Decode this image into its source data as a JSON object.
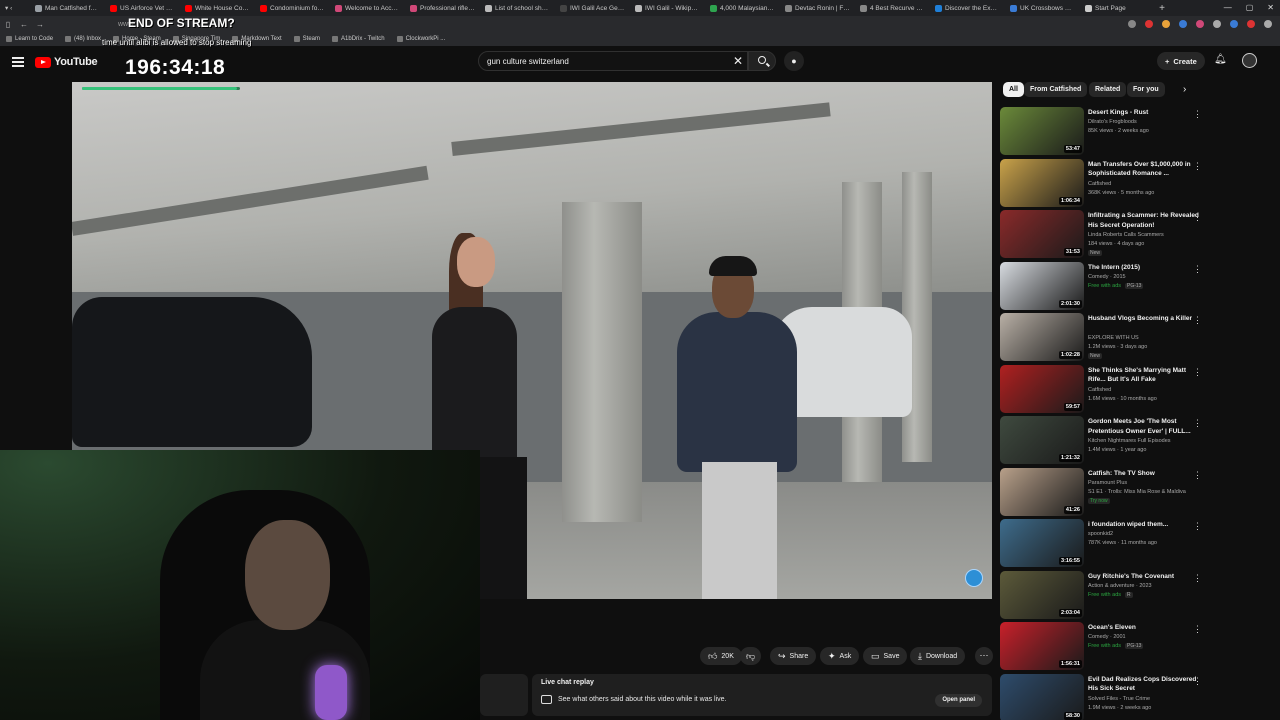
{
  "browser": {
    "tabs": [
      {
        "label": "Man Catfished for $2",
        "color": "#9aa0a6"
      },
      {
        "label": "US Airforce Vet Buys",
        "color": "#ff0000"
      },
      {
        "label": "White House Corresp",
        "color": "#ff0000"
      },
      {
        "label": "Condominium for Re",
        "color": "#ff0000"
      },
      {
        "label": "Welcome to Accurac",
        "color": "#d04878"
      },
      {
        "label": "Professional rifle syste",
        "color": "#d04878"
      },
      {
        "label": "List of school shootin",
        "color": "#bbbbbb"
      },
      {
        "label": "IWI Galil Ace Gen 2 - F",
        "color": "#444444"
      },
      {
        "label": "IWI Galil - Wikipedia",
        "color": "#bbbbbb"
      },
      {
        "label": "4,000 Malaysian ringg",
        "color": "#2ea44f"
      },
      {
        "label": "Devtac Ronin | Full Fa",
        "color": "#888888"
      },
      {
        "label": "4 Best Recurve Crossb",
        "color": "#888888"
      },
      {
        "label": "Discover the Excalibur",
        "color": "#1f7fd8"
      },
      {
        "label": "UK Crossbows with Fi",
        "color": "#3a7bd5"
      },
      {
        "label": "Start Page",
        "color": "#cccccc"
      }
    ],
    "new_tab": "+",
    "url": "www",
    "bookmarks": [
      "Learn to Code",
      "(48) Inbox",
      "Home - Steam",
      "Singapore Tim",
      "Markdown Text",
      "Steam",
      "A1bDrix - Twitch",
      "ClockworkPi ..."
    ]
  },
  "stream_overlay": {
    "title": "END OF STREAM?",
    "subtitle": "time until alibi is allowed to stop streaming",
    "timer": "196:34:18",
    "progress": 0.98
  },
  "header": {
    "logo": "YouTube",
    "search_value": "gun culture switzerland",
    "create_label": "Create"
  },
  "actions": {
    "like_count": "20K",
    "share": "Share",
    "ask": "Ask",
    "save": "Save",
    "download": "Download"
  },
  "live_chat": {
    "title": "Live chat replay",
    "description": "See what others said about this video while it was live.",
    "open_panel": "Open panel"
  },
  "chips": [
    "All",
    "From Catfished",
    "Related",
    "For you"
  ],
  "related": [
    {
      "title": "Desert Kings - Rust",
      "channel": "Dilrato's Frogbloods",
      "meta": "85K views · 2 weeks ago",
      "duration": "53:47",
      "badge": "",
      "thumb": "#6b8a3a"
    },
    {
      "title": "Man Transfers Over $1,000,000 in Sophisticated Romance ...",
      "channel": "Catfished",
      "meta": "368K views · 5 months ago",
      "duration": "1:06:34",
      "badge": "",
      "thumb": "#c9a24a"
    },
    {
      "title": "Infiltrating a Scammer: He Revealed His Secret Operation!",
      "channel": "Linda Roberts Calls Scammers",
      "meta": "184 views · 4 days ago",
      "duration": "31:53",
      "badge": "New",
      "thumb": "#8a2a2a"
    },
    {
      "title": "The Intern (2015)",
      "channel": "Comedy · 2015",
      "meta": "Free with ads",
      "duration": "2:01:30",
      "badge": "PG-13",
      "thumb": "#d7dbe0"
    },
    {
      "title": "Husband Vlogs Becoming a Killer",
      "channel": "EXPLORE WITH US",
      "meta": "1.2M views · 3 days ago",
      "duration": "1:02:28",
      "badge": "New",
      "thumb": "#b9b0a6"
    },
    {
      "title": "She Thinks She's Marrying Matt Rife... But It's All Fake",
      "channel": "Catfished",
      "meta": "1.6M views · 10 months ago",
      "duration": "59:57",
      "badge": "",
      "thumb": "#b02020"
    },
    {
      "title": "Gordon Meets Joe 'The Most Pretentious Owner Ever' | FULL...",
      "channel": "Kitchen Nightmares Full Episodes",
      "meta": "1.4M views · 1 year ago",
      "duration": "1:21:32",
      "badge": "",
      "thumb": "#3f4a3f"
    },
    {
      "title": "Catfish: The TV Show",
      "channel": "Paramount Plus",
      "meta": "S1 E1 · Trolls: Miss Mia Rose & Maldiva",
      "duration": "41:26",
      "badge": "Try now",
      "thumb": "#b8a08a"
    },
    {
      "title": "i foundation wiped them...",
      "channel": "spoonkid2",
      "meta": "787K views · 11 months ago",
      "duration": "3:16:55",
      "badge": "",
      "thumb": "#3e6c8c"
    },
    {
      "title": "Guy Ritchie's The Covenant",
      "channel": "Action & adventure · 2023",
      "meta": "Free with ads",
      "duration": "2:03:04",
      "badge": "R",
      "thumb": "#5c5a3a"
    },
    {
      "title": "Ocean's Eleven",
      "channel": "Comedy · 2001",
      "meta": "Free with ads",
      "duration": "1:56:31",
      "badge": "PG-13",
      "thumb": "#c8202a"
    },
    {
      "title": "Evil Dad Realizes Cops Discovered His Sick Secret",
      "channel": "Solved Files - True Crime",
      "meta": "1.9M views · 2 weeks ago",
      "duration": "58:30",
      "badge": "",
      "thumb": "#2e4c6c"
    }
  ]
}
